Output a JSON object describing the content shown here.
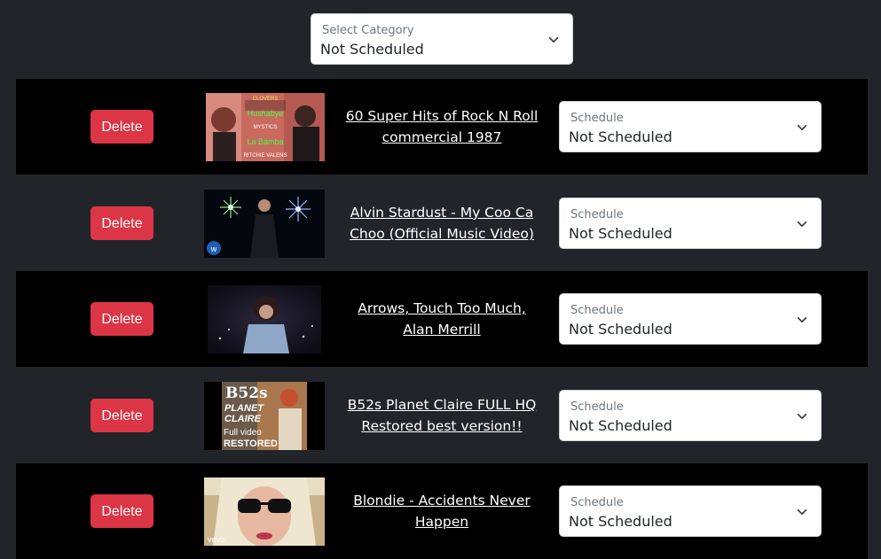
{
  "category_select": {
    "label": "Select Category",
    "value": "Not Scheduled"
  },
  "videos": [
    {
      "delete_label": "Delete",
      "title": "60 Super Hits of Rock N Roll commercial 1987",
      "schedule_label": "Schedule",
      "schedule_value": "Not Scheduled",
      "thumb_text": [
        "CLOVERS",
        "Hushabye",
        "MYSTICS",
        "La Bamba",
        "RITCHIE VALENS"
      ]
    },
    {
      "delete_label": "Delete",
      "title": "Alvin Stardust - My Coo Ca Choo (Official Music Video)",
      "schedule_label": "Schedule",
      "schedule_value": "Not Scheduled"
    },
    {
      "delete_label": "Delete",
      "title": "Arrows, Touch Too Much, Alan Merrill",
      "schedule_label": "Schedule",
      "schedule_value": "Not Scheduled"
    },
    {
      "delete_label": "Delete",
      "title": "B52s Planet Claire FULL HQ Restored best version!!",
      "schedule_label": "Schedule",
      "schedule_value": "Not Scheduled",
      "thumb_text": [
        "B52s",
        "PLANET",
        "CLAIRE",
        "Full video",
        "RESTORED"
      ]
    },
    {
      "delete_label": "Delete",
      "title": "Blondie - Accidents Never Happen",
      "schedule_label": "Schedule",
      "schedule_value": "Not Scheduled",
      "thumb_text": [
        "vevo"
      ]
    }
  ],
  "colors": {
    "page_bg": "#212529",
    "row_dark": "#000000",
    "delete": "#dc3545"
  }
}
